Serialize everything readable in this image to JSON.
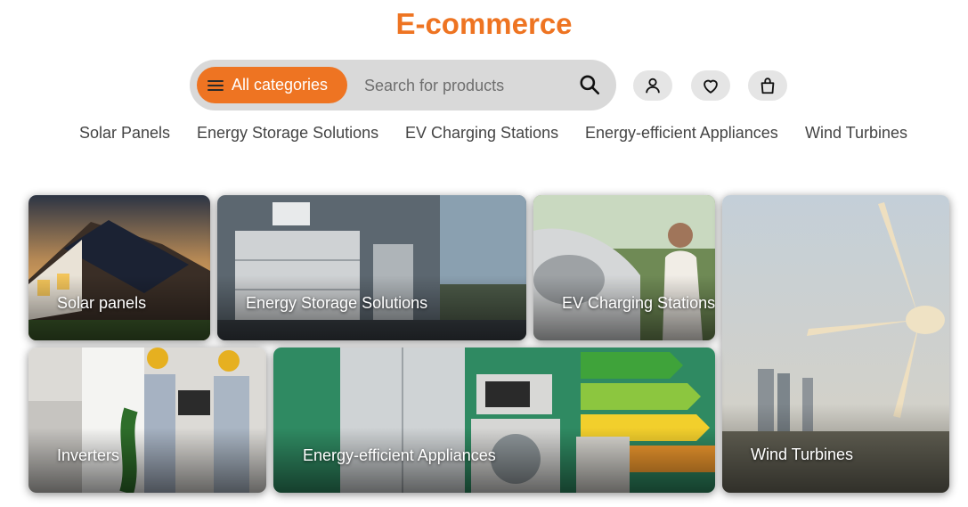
{
  "header": {
    "title": "E-commerce"
  },
  "search": {
    "category_label": "All categories",
    "placeholder": "Search for products"
  },
  "icons": {
    "menu": "hamburger-icon",
    "search": "search-icon",
    "account": "user-icon",
    "wishlist": "heart-icon",
    "cart": "shopping-bag-icon"
  },
  "nav": {
    "items": [
      {
        "label": "Solar Panels"
      },
      {
        "label": "Energy Storage Solutions"
      },
      {
        "label": "EV Charging Stations"
      },
      {
        "label": "Energy-efficient Appliances"
      },
      {
        "label": "Wind Turbines"
      }
    ]
  },
  "tiles": [
    {
      "label": "Solar panels"
    },
    {
      "label": "Energy Storage Solutions"
    },
    {
      "label": "EV Charging Stations"
    },
    {
      "label": "Inverters"
    },
    {
      "label": "Energy-efficient Appliances"
    },
    {
      "label": "Wind Turbines"
    }
  ],
  "colors": {
    "accent": "#ee7422",
    "search_bg": "#d9d9d9",
    "icon_btn_bg": "#e5e5e5",
    "nav_text": "#444444"
  }
}
